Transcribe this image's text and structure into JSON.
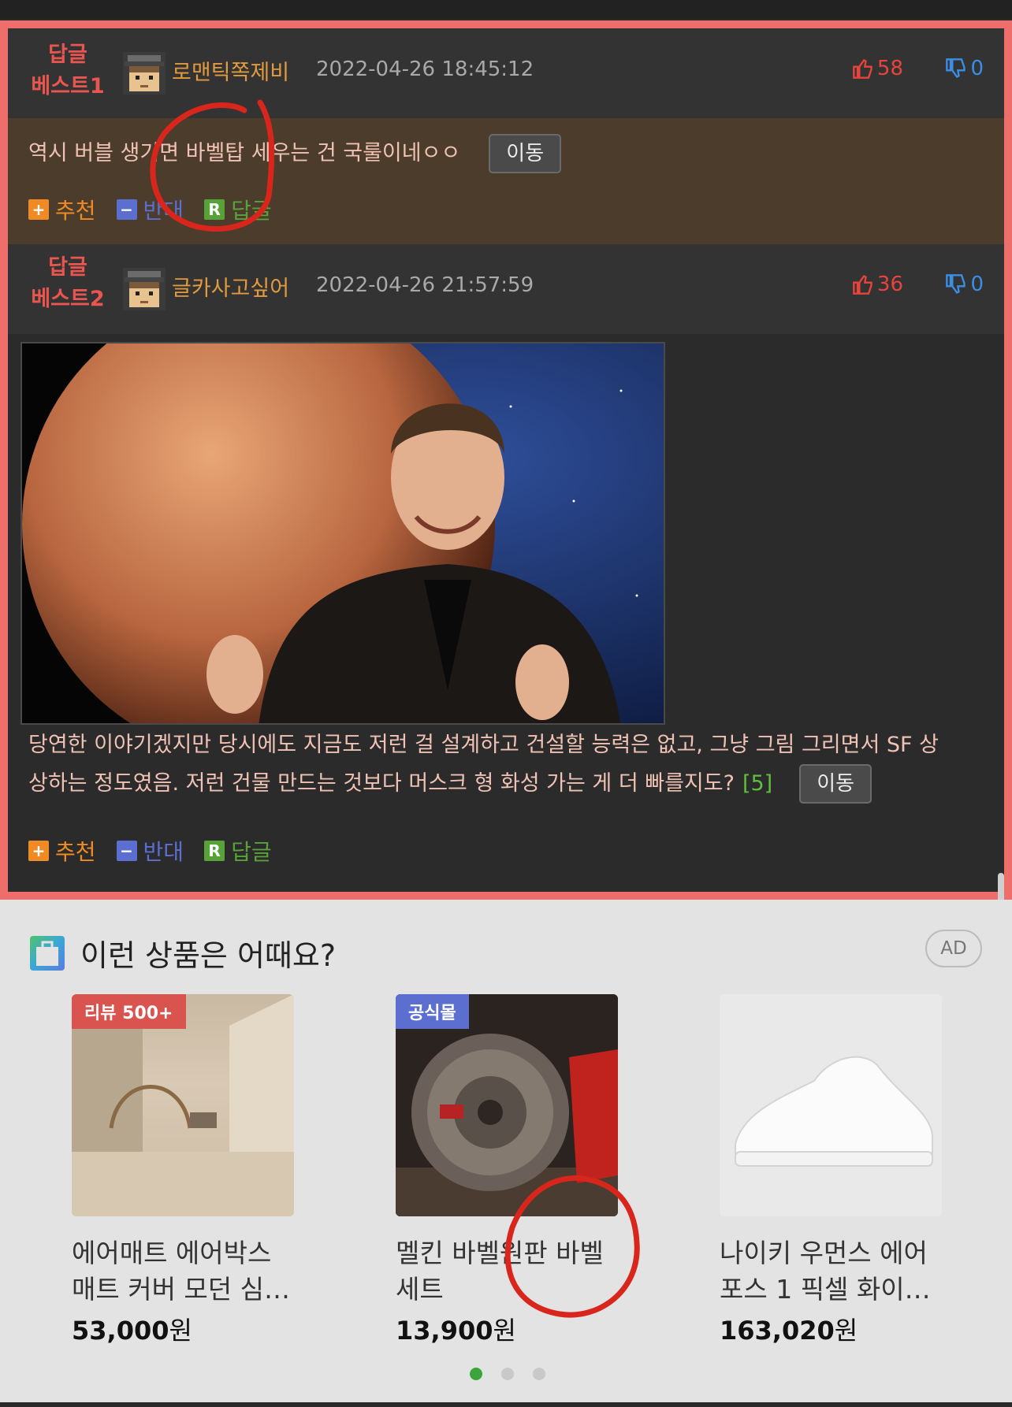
{
  "comments": [
    {
      "best_line1": "답글",
      "best_line2": "베스트1",
      "username": "로맨틱쪽제비",
      "timestamp": "2022-04-26 18:45:12",
      "likes": "58",
      "dislikes": "0",
      "text": "역시 버블 생기면 바벨탑 세우는 건 국룰이네ㅇㅇ",
      "move_label": "이동",
      "actions": {
        "recommend": "추천",
        "oppose": "반대",
        "reply": "답글"
      }
    },
    {
      "best_line1": "답글",
      "best_line2": "베스트2",
      "username": "글카사고싶어",
      "timestamp": "2022-04-26 21:57:59",
      "likes": "36",
      "dislikes": "0",
      "text_line1": "당연한 이야기겠지만 당시에도 지금도 저런 걸 설계하고 건설할 능력은 없고, 그냥 그림 그리면서 SF 상",
      "text_line2": "상하는 정도였음. 저런 건물 만드는 것보다 머스크 형 화성 가는 게 더 빠를지도?",
      "reply_count": "[5]",
      "move_label": "이동",
      "actions": {
        "recommend": "추천",
        "oppose": "반대",
        "reply": "답글"
      }
    }
  ],
  "ad": {
    "title": "이런 상품은 어때요?",
    "badge": "AD",
    "products": [
      {
        "tag": "리뷰 500+",
        "name_line1": "에어매트 에어박스",
        "name_line2": "매트 커버 모던 심…",
        "price": "53,000",
        "currency": "원"
      },
      {
        "tag": "공식몰",
        "name_line1": "멜킨 바벨원판 바벨",
        "name_line2": "세트",
        "price": "13,900",
        "currency": "원"
      },
      {
        "tag": "",
        "name_line1": "나이키 우먼스 에어",
        "name_line2": "포스 1 픽셀 화이…",
        "price": "163,020",
        "currency": "원"
      }
    ],
    "page_dots": 3,
    "active_dot": 1
  },
  "colors": {
    "panel_border": "#ee6e6c",
    "best_label": "#e8564f",
    "username": "#e29a3f",
    "like": "#e8443d",
    "dislike": "#3a8ee6",
    "recommend_icon": "#f08a24",
    "oppose_icon": "#5c6fd1",
    "reply_icon": "#58a23a"
  }
}
